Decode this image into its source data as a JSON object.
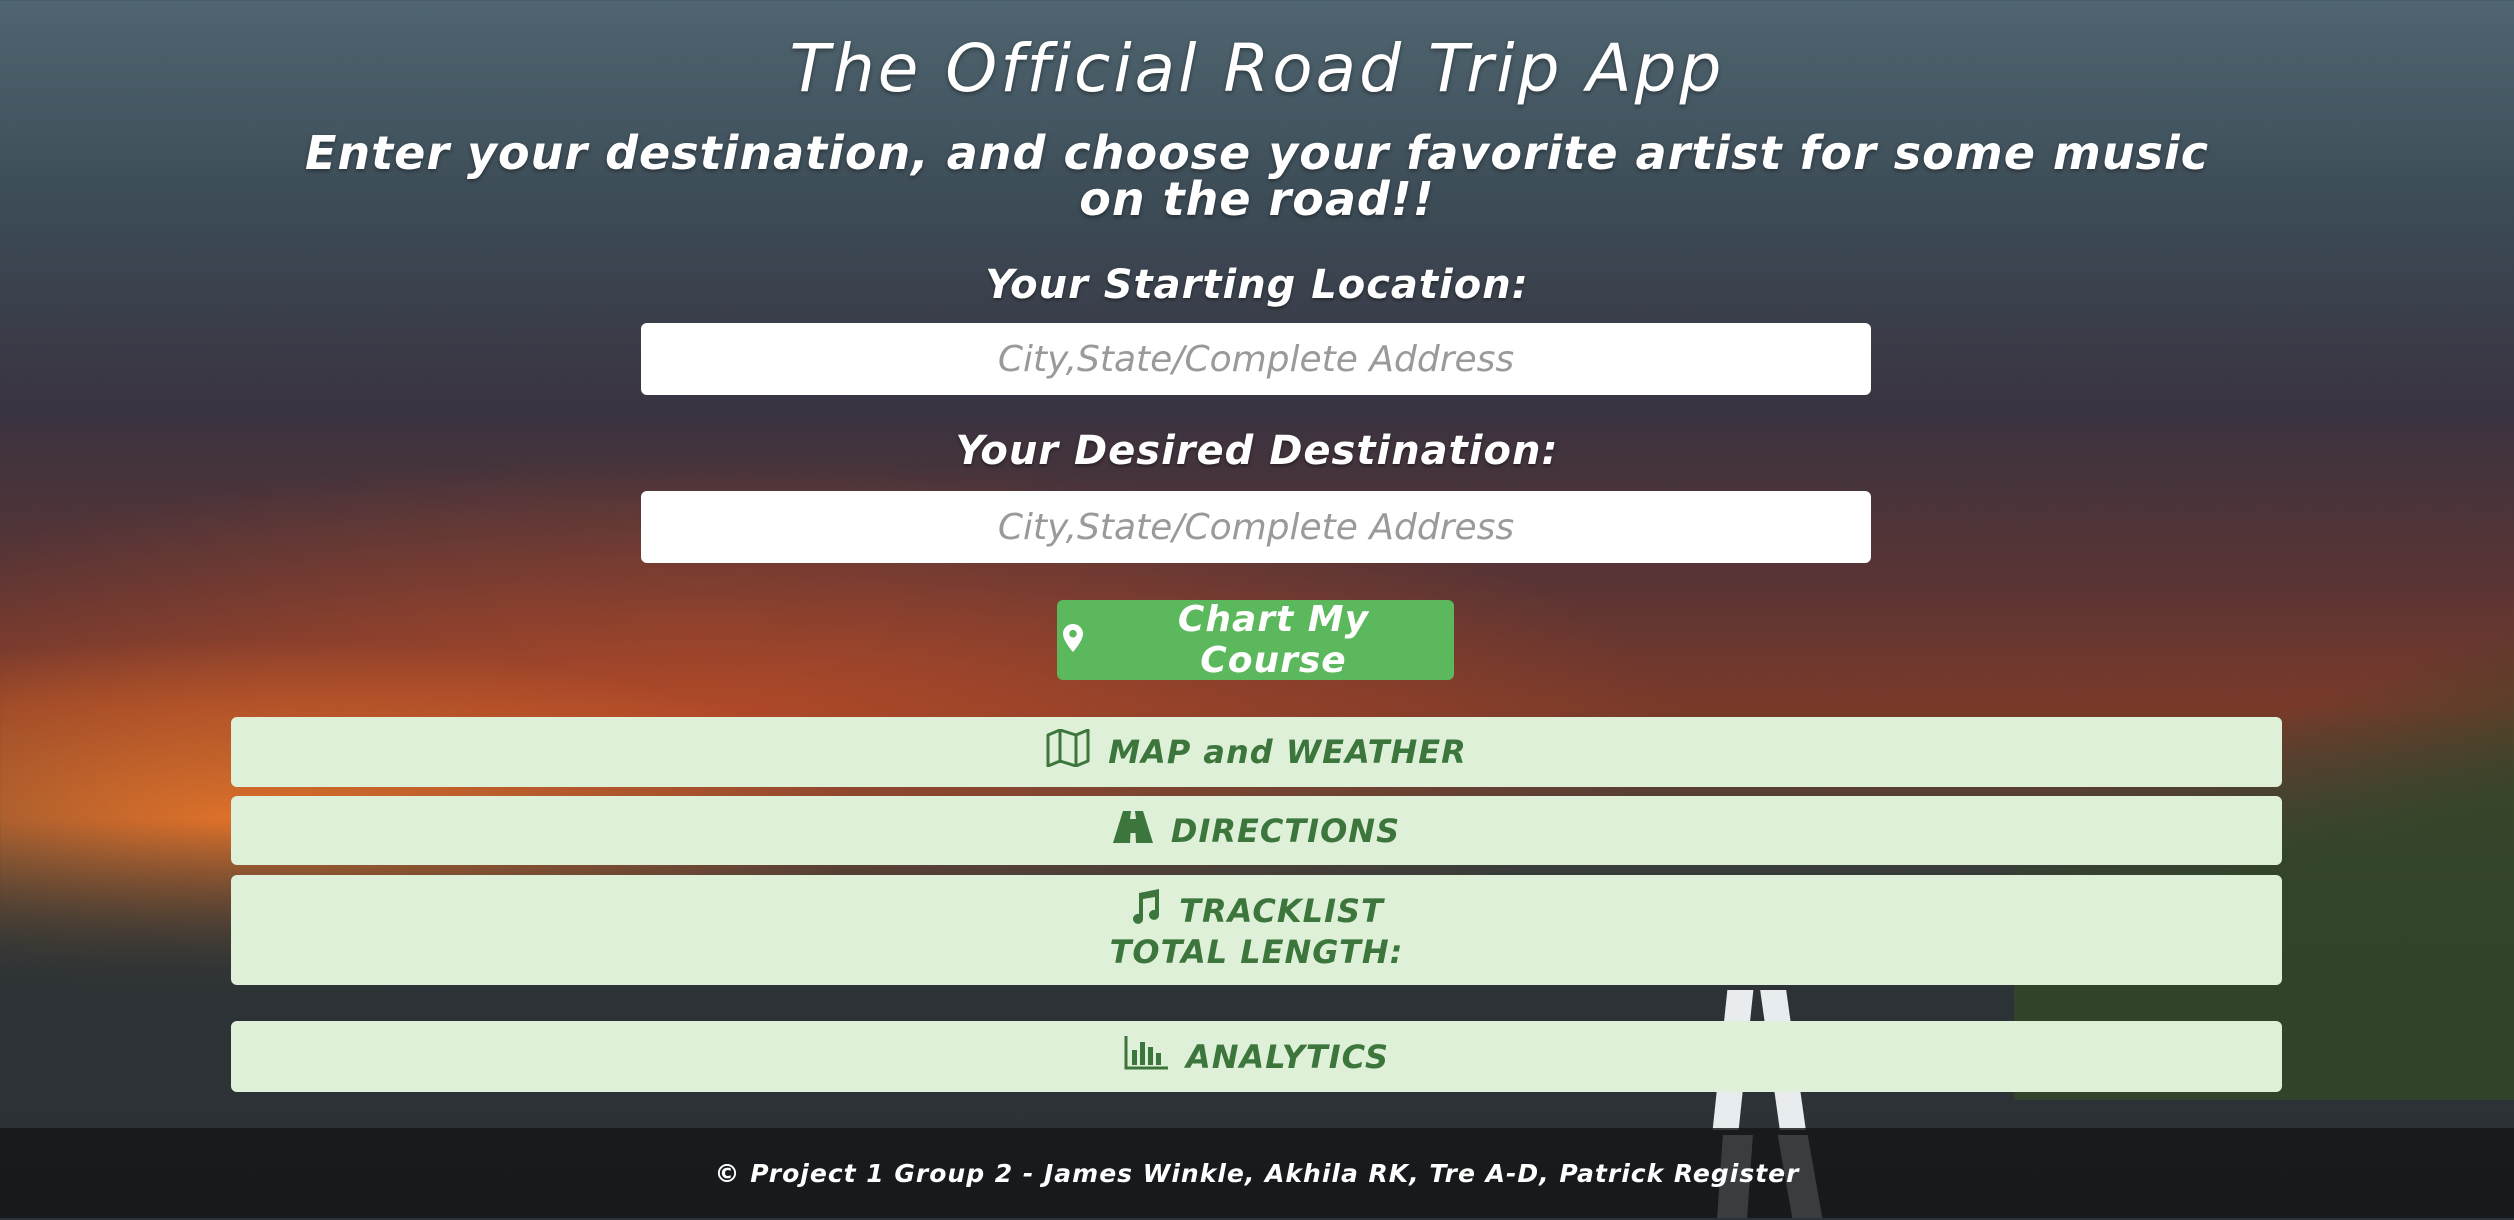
{
  "header": {
    "title": "The Official Road Trip App",
    "subtitle": "Enter your destination, and choose your favorite artist for some music on the road!!"
  },
  "form": {
    "start_label": "Your Starting Location:",
    "start_placeholder": "City,State/Complete Address",
    "destination_label": "Your Desired Destination:",
    "destination_placeholder": "City,State/Complete Address",
    "submit_label": "Chart My Course",
    "submit_icon": "map-marker-icon"
  },
  "panels": [
    {
      "label": "MAP and WEATHER",
      "icon": "map-icon"
    },
    {
      "label": "DIRECTIONS",
      "icon": "road-icon"
    },
    {
      "label": "TRACKLIST",
      "icon": "music-note-icon",
      "sub_label": "TOTAL LENGTH:"
    },
    {
      "label": "ANALYTICS",
      "icon": "bar-chart-icon"
    }
  ],
  "footer": {
    "text": "© Project 1 Group 2 - James Winkle, Akhila RK, Tre A-D, Patrick Register"
  },
  "colors": {
    "accent_button": "#5cb85c",
    "panel_bg": "#dff0d8",
    "panel_text": "#3c763d"
  }
}
